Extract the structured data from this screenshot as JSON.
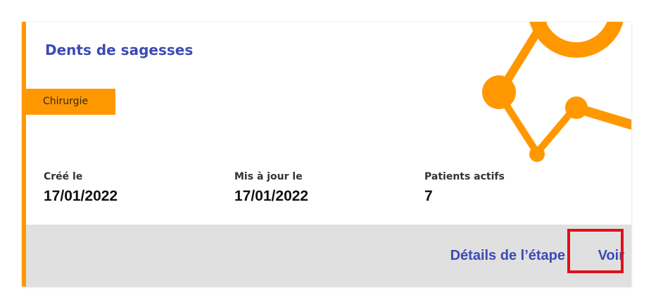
{
  "card": {
    "title": "Dents de sagesses",
    "tag": "Chirurgie",
    "stats": [
      {
        "label": "Créé le",
        "value": "17/01/2022"
      },
      {
        "label": "Mis à jour le",
        "value": "17/01/2022"
      },
      {
        "label": "Patients actifs",
        "value": "7"
      }
    ],
    "footer": {
      "details_label": "Détails de l’étape",
      "voir_label": "Voir"
    }
  },
  "colors": {
    "accent": "#FF9800",
    "link": "#3D4AB3",
    "footer_bg": "#E0E0E0",
    "highlight": "#E0101A"
  },
  "icons": {
    "decoration": "molecule-graphic"
  }
}
